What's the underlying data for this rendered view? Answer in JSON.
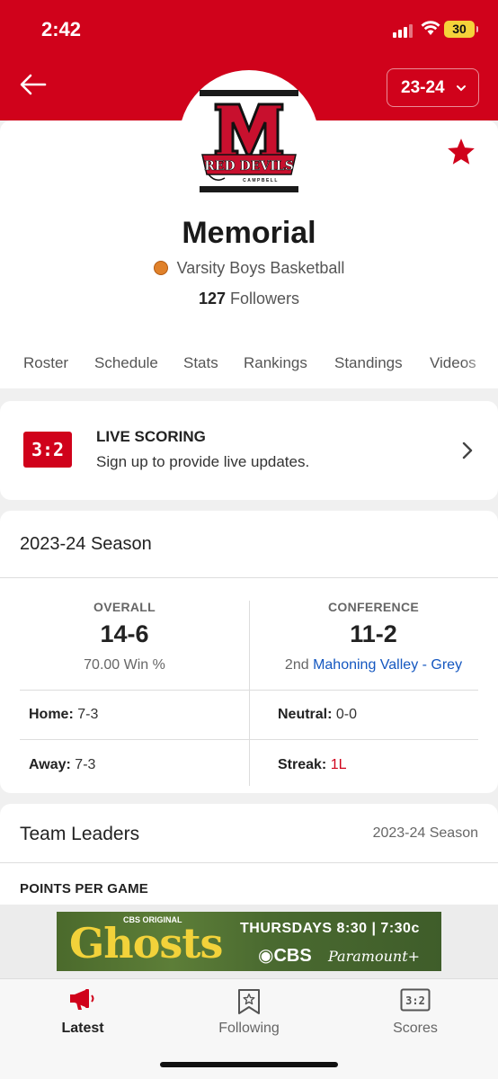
{
  "status_bar": {
    "time": "2:42",
    "battery": "30"
  },
  "header": {
    "season_select": "23-24"
  },
  "logo": {
    "letter": "M",
    "text": "RED DEVILS",
    "subtext": "CAMPBELL"
  },
  "team": {
    "name": "Memorial",
    "sport": "Varsity Boys Basketball",
    "followers_count": "127",
    "followers_label": "Followers"
  },
  "tabs": [
    "Roster",
    "Schedule",
    "Stats",
    "Rankings",
    "Standings",
    "Videos"
  ],
  "live_scoring": {
    "badge": "3:2",
    "title": "LIVE SCORING",
    "subtitle": "Sign up to provide live updates."
  },
  "season": {
    "title": "2023-24 Season",
    "overall": {
      "label": "OVERALL",
      "record": "14-6",
      "win_pct": "70.00 Win %"
    },
    "conference": {
      "label": "CONFERENCE",
      "record": "11-2",
      "place": "2nd",
      "name": "Mahoning Valley - Grey"
    },
    "home": {
      "label": "Home:",
      "value": "7-3"
    },
    "away": {
      "label": "Away:",
      "value": "7-3"
    },
    "neutral": {
      "label": "Neutral:",
      "value": "0-0"
    },
    "streak": {
      "label": "Streak:",
      "value": "1L"
    }
  },
  "leaders": {
    "title": "Team Leaders",
    "season": "2023-24 Season",
    "category": "POINTS PER GAME"
  },
  "ad": {
    "brand": "CBS ORIGINAL",
    "show": "Ghosts",
    "when": "THURSDAYS 8:30 | 7:30c",
    "network": "◉CBS",
    "streaming": "Paramount+"
  },
  "bottom_nav": [
    {
      "label": "Latest",
      "icon": "megaphone-icon",
      "active": true
    },
    {
      "label": "Following",
      "icon": "bookmark-star-icon",
      "active": false
    },
    {
      "label": "Scores",
      "icon": "scoreboard-icon",
      "active": false
    }
  ],
  "colors": {
    "brand_red": "#d0021b",
    "link_blue": "#1457c0"
  }
}
